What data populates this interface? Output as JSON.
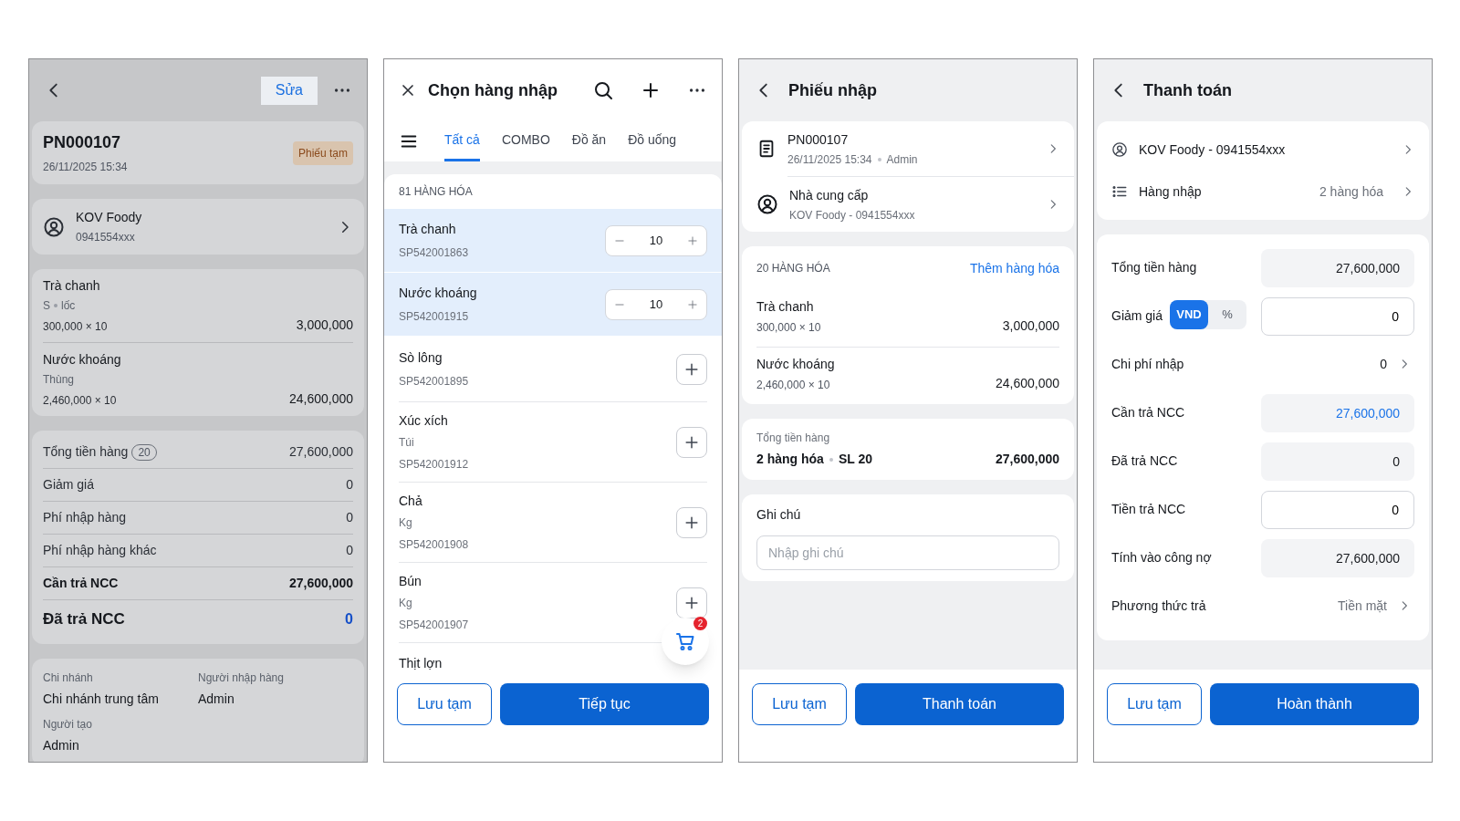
{
  "detail_screen": {
    "edit_button": "Sửa",
    "code": "PN000107",
    "datetime": "26/11/2025 15:34",
    "status_badge": "Phiếu tạm",
    "supplier": {
      "name": "KOV Foody",
      "phone": "0941554xxx"
    },
    "items": [
      {
        "name": "Trà chanh",
        "attributes": [
          "S",
          "lốc"
        ],
        "price_qty": "300,000 × 10",
        "amount": "3,000,000"
      },
      {
        "name": "Nước khoáng",
        "attributes": [
          "Thùng"
        ],
        "price_qty": "2,460,000 × 10",
        "amount": "24,600,000"
      }
    ],
    "summary": [
      {
        "kind": "normal",
        "label": "Tổng tiền hàng",
        "count": "20",
        "value": "27,600,000"
      },
      {
        "kind": "normal",
        "label": "Giảm giá",
        "value": "0"
      },
      {
        "kind": "normal",
        "label": "Phí nhập hàng",
        "value": "0"
      },
      {
        "kind": "normal",
        "label": "Phí nhập hàng khác",
        "value": "0"
      },
      {
        "kind": "strong",
        "label": "Cần trả NCC",
        "value": "27,600,000"
      },
      {
        "kind": "emphasis",
        "label": "Đã trả NCC",
        "value": "0"
      }
    ],
    "info": [
      {
        "label": "Chi nhánh",
        "value": "Chi nhánh trung tâm"
      },
      {
        "label": "Người nhập hàng",
        "value": "Admin"
      },
      {
        "label": "Người tạo",
        "value": "Admin"
      }
    ]
  },
  "picker_screen": {
    "title": "Chọn hàng nhập",
    "tabs": [
      {
        "label": "Tất cả",
        "selected": true
      },
      {
        "label": "COMBO",
        "selected": false
      },
      {
        "label": "Đồ ăn",
        "selected": false
      },
      {
        "label": "Đồ uống",
        "selected": false
      }
    ],
    "count_label": "81 HÀNG HÓA",
    "products": [
      {
        "name": "Trà chanh",
        "sku": "SP542001863",
        "selected": true,
        "quantity": "10"
      },
      {
        "name": "Nước khoáng",
        "sku": "SP542001915",
        "selected": true,
        "quantity": "10"
      },
      {
        "name": "Sò lông",
        "sku": "SP542001895",
        "selected": false
      },
      {
        "name": "Xúc xích",
        "unit": "Túi",
        "sku": "SP542001912",
        "selected": false
      },
      {
        "name": "Chả",
        "unit": "Kg",
        "sku": "SP542001908",
        "selected": false
      },
      {
        "name": "Bún",
        "unit": "Kg",
        "sku": "SP542001907",
        "selected": false
      },
      {
        "name": "Thịt lợn",
        "selected": false
      }
    ],
    "cart_count": "2",
    "buttons": [
      "Lưu tạm",
      "Tiếp tục"
    ]
  },
  "receipt_screen": {
    "title": "Phiếu nhập",
    "document": {
      "code": "PN000107",
      "meta": [
        "26/11/2025 15:34",
        "Admin"
      ]
    },
    "supplier": {
      "label": "Nhà cung cấp",
      "detail": "KOV Foody - 0941554xxx"
    },
    "items_header": "20 HÀNG HÓA",
    "add_link": "Thêm hàng hóa",
    "items": [
      {
        "name": "Trà chanh",
        "price_qty": "300,000 × 10",
        "amount": "3,000,000"
      },
      {
        "name": "Nước khoáng",
        "price_qty": "2,460,000 × 10",
        "amount": "24,600,000"
      }
    ],
    "total": {
      "label": "Tổng tiền hàng",
      "parts": [
        "2 hàng hóa",
        "SL 20"
      ],
      "amount": "27,600,000"
    },
    "note": {
      "label": "Ghi chú",
      "placeholder": "Nhập ghi chú"
    },
    "buttons": [
      "Lưu tạm",
      "Thanh toán"
    ]
  },
  "payment_screen": {
    "title": "Thanh toán",
    "supplier": "KOV Foody - 0941554xxx",
    "goods": {
      "label": "Hàng nhập",
      "value": "2 hàng hóa"
    },
    "rows": [
      {
        "kind": "readonly",
        "label": "Tổng tiền hàng",
        "value": "27,600,000"
      },
      {
        "kind": "discount",
        "label": "Giảm giá",
        "units": [
          {
            "label": "VND",
            "selected": true
          },
          {
            "label": "%",
            "selected": false
          }
        ],
        "value": "0"
      },
      {
        "kind": "cost",
        "label": "Chi phí nhập",
        "value": "0"
      },
      {
        "kind": "total",
        "label": "Cần trả NCC",
        "value": "27,600,000"
      },
      {
        "kind": "readonly",
        "label": "Đã trả NCC",
        "value": "0"
      },
      {
        "kind": "input",
        "label": "Tiền trả NCC",
        "value": "0"
      },
      {
        "kind": "readonly",
        "label": "Tính vào công nợ",
        "value": "27,600,000"
      },
      {
        "kind": "select",
        "label": "Phương thức trả",
        "value": "Tiền mặt"
      }
    ],
    "buttons": [
      "Lưu tạm",
      "Hoàn thành"
    ]
  }
}
